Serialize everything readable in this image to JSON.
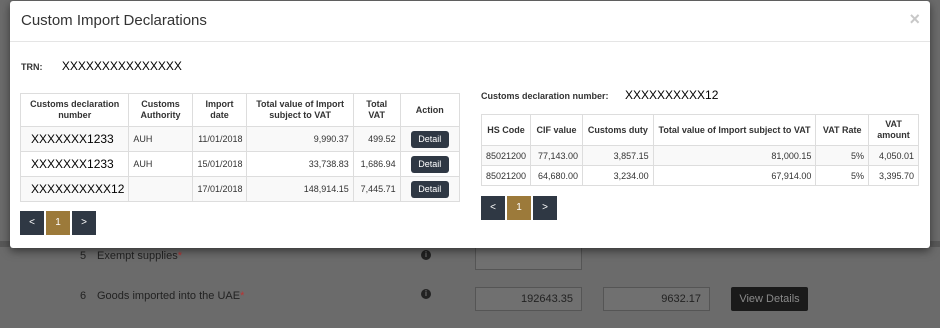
{
  "background": {
    "rows": [
      {
        "num": "5",
        "label": "Exempt supplies",
        "required": "*"
      },
      {
        "num": "6",
        "label": "Goods imported into the UAE",
        "required": "*",
        "value1": "192643.35",
        "value2": "9632.17"
      }
    ],
    "info_glyph": "i",
    "view_details_label": "View Details"
  },
  "modal": {
    "title": "Custom Import Declarations",
    "close_glyph": "×",
    "trn_label": "TRN:",
    "trn_value": "XXXXXXXXXXXXXXX",
    "left_table": {
      "headers": [
        "Customs declaration number",
        "Customs Authority",
        "Import date",
        "Total value of Import subject to VAT",
        "Total VAT",
        "Action"
      ],
      "rows": [
        {
          "number": "XXXXXXX1233",
          "authority": "AUH",
          "date": "11/01/2018",
          "total": "9,990.37",
          "vat": "499.52",
          "action": "Detail"
        },
        {
          "number": "XXXXXXX1233",
          "authority": "AUH",
          "date": "15/01/2018",
          "total": "33,738.83",
          "vat": "1,686.94",
          "action": "Detail"
        },
        {
          "number": "XXXXXXXXXX12",
          "authority": "",
          "date": "17/01/2018",
          "total": "148,914.15",
          "vat": "7,445.71",
          "action": "Detail"
        }
      ]
    },
    "left_pager": {
      "prev": "<",
      "page": "1",
      "next": ">"
    },
    "declaration_label": "Customs declaration number:",
    "declaration_value": "XXXXXXXXXX12",
    "right_table": {
      "headers": [
        "HS Code",
        "CIF value",
        "Customs duty",
        "Total value of Import subject to VAT",
        "VAT Rate",
        "VAT amount"
      ],
      "rows": [
        {
          "hs": "85021200",
          "cif": "77,143.00",
          "duty": "3,857.15",
          "total": "81,000.15",
          "rate": "5%",
          "amount": "4,050.01"
        },
        {
          "hs": "85021200",
          "cif": "64,680.00",
          "duty": "3,234.00",
          "total": "67,914.00",
          "rate": "5%",
          "amount": "3,395.70"
        }
      ]
    },
    "right_pager": {
      "prev": "<",
      "page": "1",
      "next": ">"
    }
  },
  "colors": {
    "button_dark": "#2f3844",
    "page_active": "#9c7a3a"
  }
}
